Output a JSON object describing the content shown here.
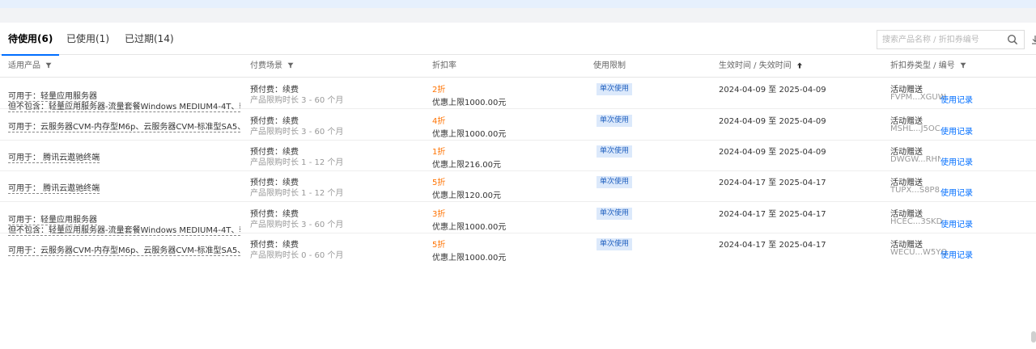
{
  "tabs": [
    {
      "label": "待使用(6)",
      "active": true
    },
    {
      "label": "已使用(1)",
      "active": false
    },
    {
      "label": "已过期(14)",
      "active": false
    }
  ],
  "search": {
    "placeholder": "搜索产品名称 / 折扣券编号"
  },
  "columns": {
    "product": "适用产品",
    "scene": "付费场景",
    "rate": "折扣率",
    "limit": "使用限制",
    "time": "生效时间 / 失效时间",
    "type": "折扣券类型 / 编号"
  },
  "rows": [
    {
      "product": "可用于：轻量应用服务器",
      "exclude": "但不包含：轻量应用服务器-流量套餐Windows MEDIUM4-4T、轻量应用...",
      "scene": "预付费：续费",
      "term": "产品限购时长 3 - 60 个月",
      "rate": "2折",
      "cap": "优惠上限1000.00元",
      "limit": "单次使用",
      "time": "2024-04-09 至 2025-04-09",
      "type": "活动赠送",
      "code": "FVPM...XGUW",
      "record": "使用记录"
    },
    {
      "product": "可用于：云服务器CVM-内存型M6p、云服务器CVM-标准型SA5、云服...",
      "exclude": "",
      "scene": "预付费：续费",
      "term": "产品限购时长 3 - 60 个月",
      "rate": "4折",
      "cap": "优惠上限1000.00元",
      "limit": "单次使用",
      "time": "2024-04-09 至 2025-04-09",
      "type": "活动赠送",
      "code": "MSHL...J5OC",
      "record": "使用记录"
    },
    {
      "product": "可用于： 腾讯云遨驰终端",
      "exclude": "",
      "scene": "预付费：续费",
      "term": "产品限购时长 1 - 12 个月",
      "rate": "1折",
      "cap": "优惠上限216.00元",
      "limit": "单次使用",
      "time": "2024-04-09 至 2025-04-09",
      "type": "活动赠送",
      "code": "DWGW...RHNN",
      "record": "使用记录"
    },
    {
      "product": "可用于： 腾讯云遨驰终端",
      "exclude": "",
      "scene": "预付费：续费",
      "term": "产品限购时长 1 - 12 个月",
      "rate": "5折",
      "cap": "优惠上限120.00元",
      "limit": "单次使用",
      "time": "2024-04-17 至 2025-04-17",
      "type": "活动赠送",
      "code": "TUPX...S8P8",
      "record": "使用记录"
    },
    {
      "product": "可用于：轻量应用服务器",
      "exclude": "但不包含：轻量应用服务器-流量套餐Windows MEDIUM4-4T、轻量应用...",
      "scene": "预付费：续费",
      "term": "产品限购时长 3 - 60 个月",
      "rate": "3折",
      "cap": "优惠上限1000.00元",
      "limit": "单次使用",
      "time": "2024-04-17 至 2025-04-17",
      "type": "活动赠送",
      "code": "HCEC...3SKD",
      "record": "使用记录"
    },
    {
      "product": "可用于：云服务器CVM-内存型M6p、云服务器CVM-标准型SA5、云服...",
      "exclude": "",
      "scene": "预付费：续费",
      "term": "产品限购时长 0 - 60 个月",
      "rate": "5折",
      "cap": "优惠上限1000.00元",
      "limit": "单次使用",
      "time": "2024-04-17 至 2025-04-17",
      "type": "活动赠送",
      "code": "WECU...W5YQ",
      "record": "使用记录"
    }
  ]
}
